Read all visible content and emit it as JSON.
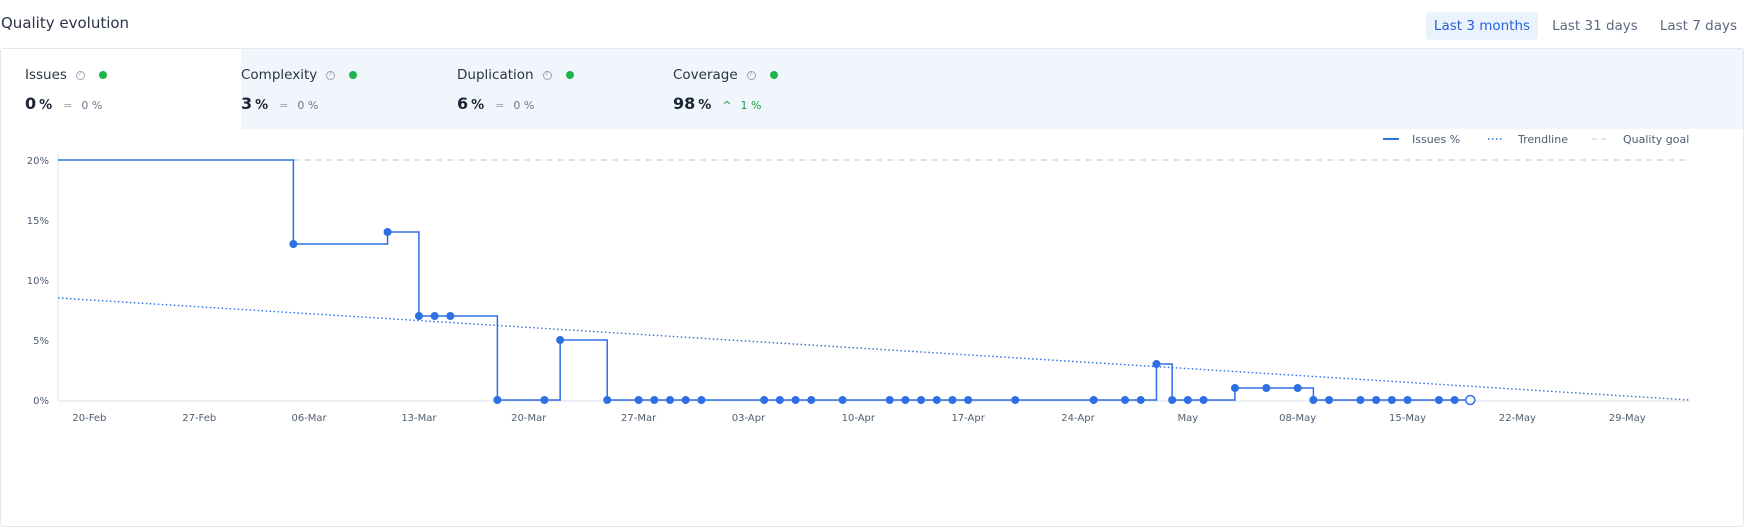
{
  "header": {
    "title": "Quality evolution",
    "ranges": [
      "Last 3 months",
      "Last 31 days",
      "Last 7 days"
    ],
    "active_range": 0
  },
  "metrics": [
    {
      "name": "Issues",
      "value": "0",
      "unit": "%",
      "delta_symbol": "=",
      "delta": "0 %",
      "status_color": "#1fb34e",
      "delta_dir": "equal"
    },
    {
      "name": "Complexity",
      "value": "3",
      "unit": "%",
      "delta_symbol": "=",
      "delta": "0 %",
      "status_color": "#1fb34e",
      "delta_dir": "equal"
    },
    {
      "name": "Duplication",
      "value": "6",
      "unit": "%",
      "delta_symbol": "=",
      "delta": "0 %",
      "status_color": "#1fb34e",
      "delta_dir": "equal"
    },
    {
      "name": "Coverage",
      "value": "98",
      "unit": "%",
      "delta_symbol": "^",
      "delta": "1 %",
      "status_color": "#1fb34e",
      "delta_dir": "up"
    }
  ],
  "colors": {
    "series": "#2f6fe4",
    "trend": "#2f6fe4",
    "goal": "#c5d2e2",
    "accent": "#2563d8"
  },
  "chart_data": {
    "type": "line",
    "legend": [
      "Issues %",
      "Trendline",
      "Quality goal"
    ],
    "legend_position": "top-right",
    "y_ticks": [
      0,
      5,
      10,
      15,
      20
    ],
    "y_tick_labels": [
      "0%",
      "5%",
      "10%",
      "15%",
      "20%"
    ],
    "ylim": [
      0,
      24
    ],
    "x_tick_labels": [
      "20-Feb",
      "27-Feb",
      "06-Mar",
      "13-Mar",
      "20-Mar",
      "27-Mar",
      "03-Apr",
      "10-Apr",
      "17-Apr",
      "24-Apr",
      "May",
      "08-May",
      "15-May",
      "22-May",
      "29-May"
    ],
    "x_tick_dates": [
      "2023-02-20",
      "2023-02-27",
      "2023-03-06",
      "2023-03-13",
      "2023-03-20",
      "2023-03-27",
      "2023-04-03",
      "2023-04-10",
      "2023-04-17",
      "2023-04-24",
      "2023-05-01",
      "2023-05-08",
      "2023-05-15",
      "2023-05-22",
      "2023-05-29"
    ],
    "xlim": [
      "2023-02-18",
      "2023-06-02"
    ],
    "series": [
      {
        "name": "Issues %",
        "step": true,
        "points": [
          [
            "2023-02-18",
            20
          ],
          [
            "2023-03-05",
            13
          ],
          [
            "2023-03-11",
            14
          ],
          [
            "2023-03-13",
            7
          ],
          [
            "2023-03-14",
            7
          ],
          [
            "2023-03-15",
            7
          ],
          [
            "2023-03-18",
            0
          ],
          [
            "2023-03-21",
            0
          ],
          [
            "2023-03-22",
            5
          ],
          [
            "2023-03-25",
            0
          ],
          [
            "2023-03-27",
            0
          ],
          [
            "2023-03-28",
            0
          ],
          [
            "2023-03-29",
            0
          ],
          [
            "2023-03-30",
            0
          ],
          [
            "2023-03-31",
            0
          ],
          [
            "2023-04-04",
            0
          ],
          [
            "2023-04-05",
            0
          ],
          [
            "2023-04-06",
            0
          ],
          [
            "2023-04-07",
            0
          ],
          [
            "2023-04-09",
            0
          ],
          [
            "2023-04-12",
            0
          ],
          [
            "2023-04-13",
            0
          ],
          [
            "2023-04-14",
            0
          ],
          [
            "2023-04-15",
            0
          ],
          [
            "2023-04-16",
            0
          ],
          [
            "2023-04-17",
            0
          ],
          [
            "2023-04-20",
            0
          ],
          [
            "2023-04-25",
            0
          ],
          [
            "2023-04-27",
            0
          ],
          [
            "2023-04-28",
            0
          ],
          [
            "2023-04-29",
            3
          ],
          [
            "2023-04-30",
            0
          ],
          [
            "2023-05-01",
            0
          ],
          [
            "2023-05-02",
            0
          ],
          [
            "2023-05-04",
            1
          ],
          [
            "2023-05-06",
            1
          ],
          [
            "2023-05-08",
            1
          ],
          [
            "2023-05-09",
            0
          ],
          [
            "2023-05-10",
            0
          ],
          [
            "2023-05-12",
            0
          ],
          [
            "2023-05-13",
            0
          ],
          [
            "2023-05-14",
            0
          ],
          [
            "2023-05-15",
            0
          ],
          [
            "2023-05-17",
            0
          ],
          [
            "2023-05-18",
            0
          ],
          [
            "2023-05-19",
            0
          ]
        ],
        "last_point_hollow": true
      },
      {
        "name": "Trendline",
        "style": "dotted",
        "points": [
          [
            "2023-02-18",
            8.5
          ],
          [
            "2023-06-02",
            0
          ]
        ]
      },
      {
        "name": "Quality goal",
        "style": "dashed",
        "points": [
          [
            "2023-03-05",
            20
          ],
          [
            "2023-06-02",
            20
          ]
        ]
      }
    ]
  }
}
